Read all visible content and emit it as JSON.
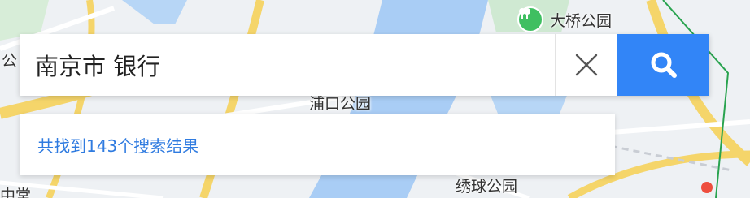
{
  "map": {
    "labels": {
      "park_top": "大桥公园",
      "park_middle": "浦口公园",
      "park_bottom": "绣球公园",
      "left_edge_top": "公",
      "left_edge_bottom": "中堂"
    },
    "colors": {
      "water": "#9ec7f3",
      "road_major": "#f5d56a",
      "park_green": "#3fbf61",
      "marker_red": "#ee4e3e"
    }
  },
  "search": {
    "query": "南京市 银行",
    "clear_icon": "close-icon",
    "search_icon": "search-icon",
    "accent": "#3285f7"
  },
  "results": {
    "summary": "共找到143个搜索结果",
    "color": "#2f7be0"
  }
}
